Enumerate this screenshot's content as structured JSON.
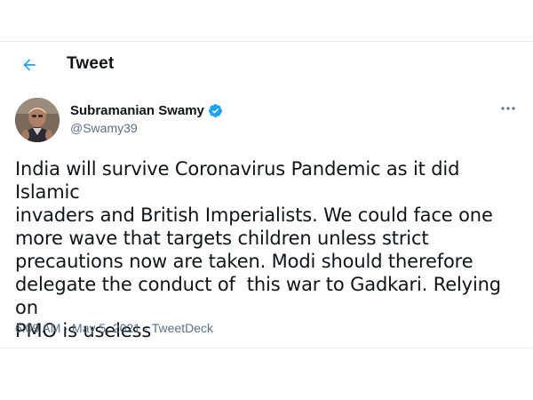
{
  "header": {
    "title": "Tweet",
    "back_icon": "arrow-left-icon"
  },
  "tweet": {
    "author": {
      "display_name": "Subramanian Swamy",
      "handle": "@Swamy39",
      "verified_icon": "verified-badge-icon"
    },
    "more_icon": "more-horizontal-icon",
    "text": "India will survive Coronavirus Pandemic as it did Islamic\ninvaders and British Imperialists. We could face one\nmore wave that targets children unless strict\nprecautions now are taken. Modi should therefore\ndelegate the conduct of  this war to Gadkari. Relying on\nPMO is useless",
    "time": "6:09 AM",
    "separator": "·",
    "date": "May 5, 2021",
    "source": "TweetDeck"
  },
  "colors": {
    "accent": "#1da1f2",
    "text_primary": "#0f1419",
    "text_secondary": "#5b7083",
    "border": "#e7ecf0"
  }
}
